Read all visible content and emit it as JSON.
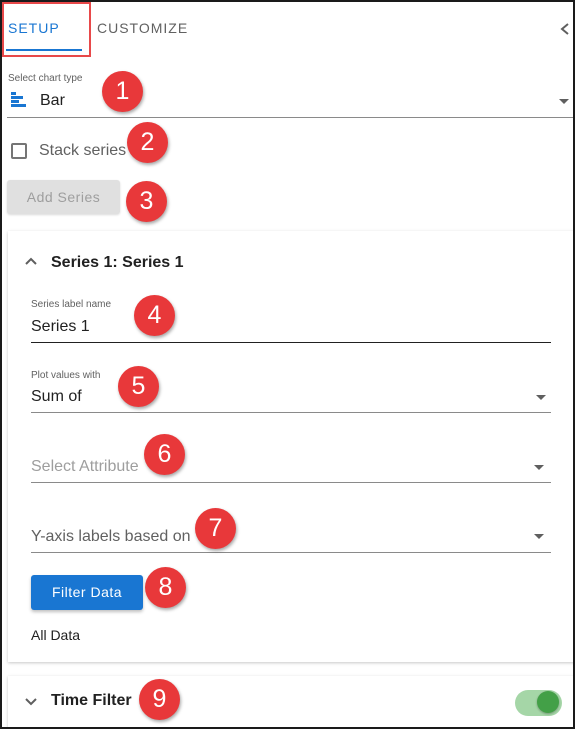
{
  "tabs": {
    "setup": "SETUP",
    "customize": "CUSTOMIZE"
  },
  "chart_type": {
    "label": "Select chart type",
    "value": "Bar"
  },
  "stack_series": {
    "label": "Stack series",
    "checked": false
  },
  "add_series": {
    "label": "Add Series"
  },
  "series_panel": {
    "title": "Series 1: Series 1",
    "series_label": {
      "label": "Series label name",
      "value": "Series 1"
    },
    "plot_values": {
      "label": "Plot values with",
      "value": "Sum of"
    },
    "attribute": {
      "placeholder": "Select Attribute"
    },
    "y_axis": {
      "placeholder": "Y-axis labels based on"
    },
    "filter_button": "Filter Data",
    "filter_status": "All Data"
  },
  "time_filter": {
    "title": "Time Filter",
    "enabled": true
  },
  "annotations": [
    "1",
    "2",
    "3",
    "4",
    "5",
    "6",
    "7",
    "8",
    "9"
  ],
  "colors": {
    "accent": "#1976d2",
    "badge": "#e8383a",
    "toggle": "#43a047",
    "highlight": "#e8494a"
  }
}
